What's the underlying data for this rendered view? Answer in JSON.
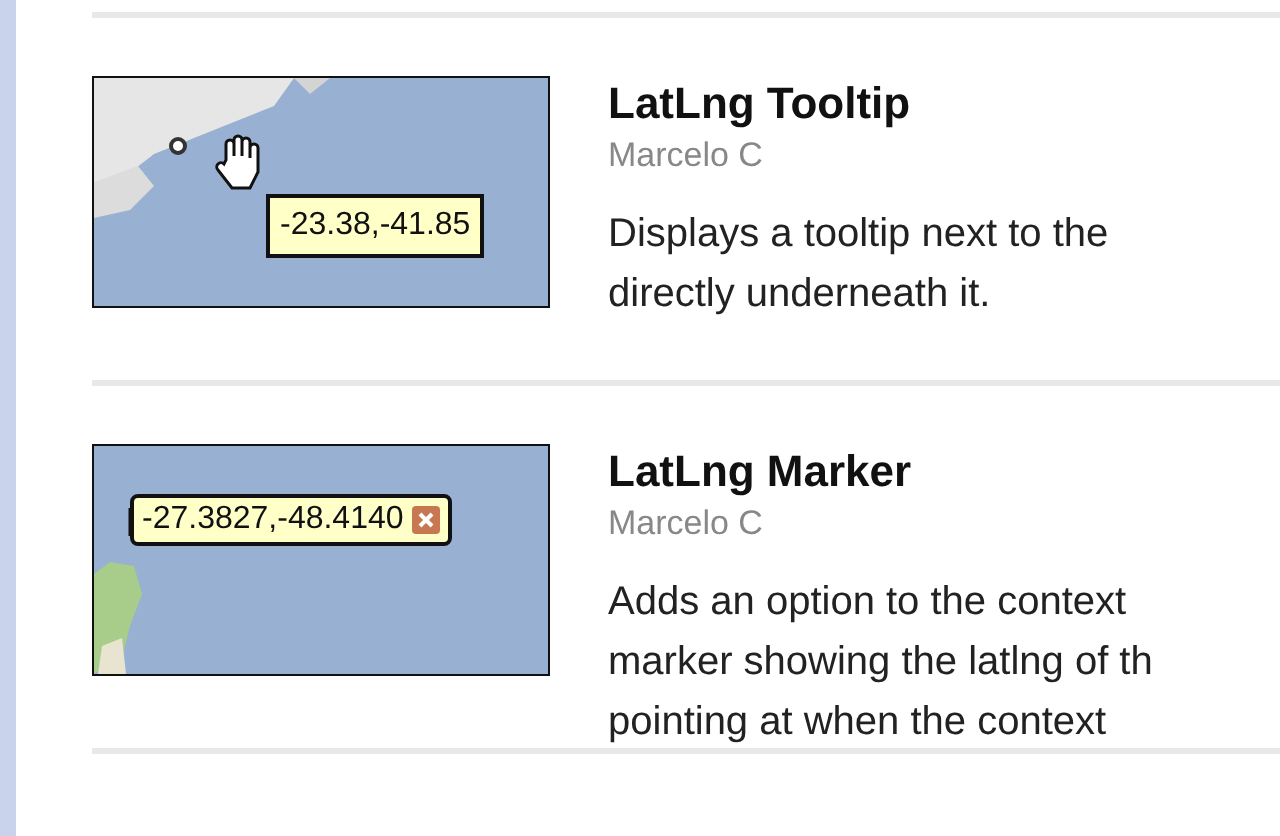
{
  "items": [
    {
      "title": "LatLng Tooltip",
      "author": "Marcelo C",
      "description": [
        "Displays a tooltip next to the",
        "directly underneath it."
      ],
      "thumbnail": {
        "kind": "box",
        "tooltip": "-23.38,-41.85"
      }
    },
    {
      "title": "LatLng Marker",
      "author": "Marcelo C",
      "description": [
        "Adds an option to the context",
        "marker showing the latlng of th",
        "pointing at when the context"
      ],
      "thumbnail": {
        "kind": "bubble",
        "tooltip": "-27.3827,-48.4140"
      }
    }
  ]
}
